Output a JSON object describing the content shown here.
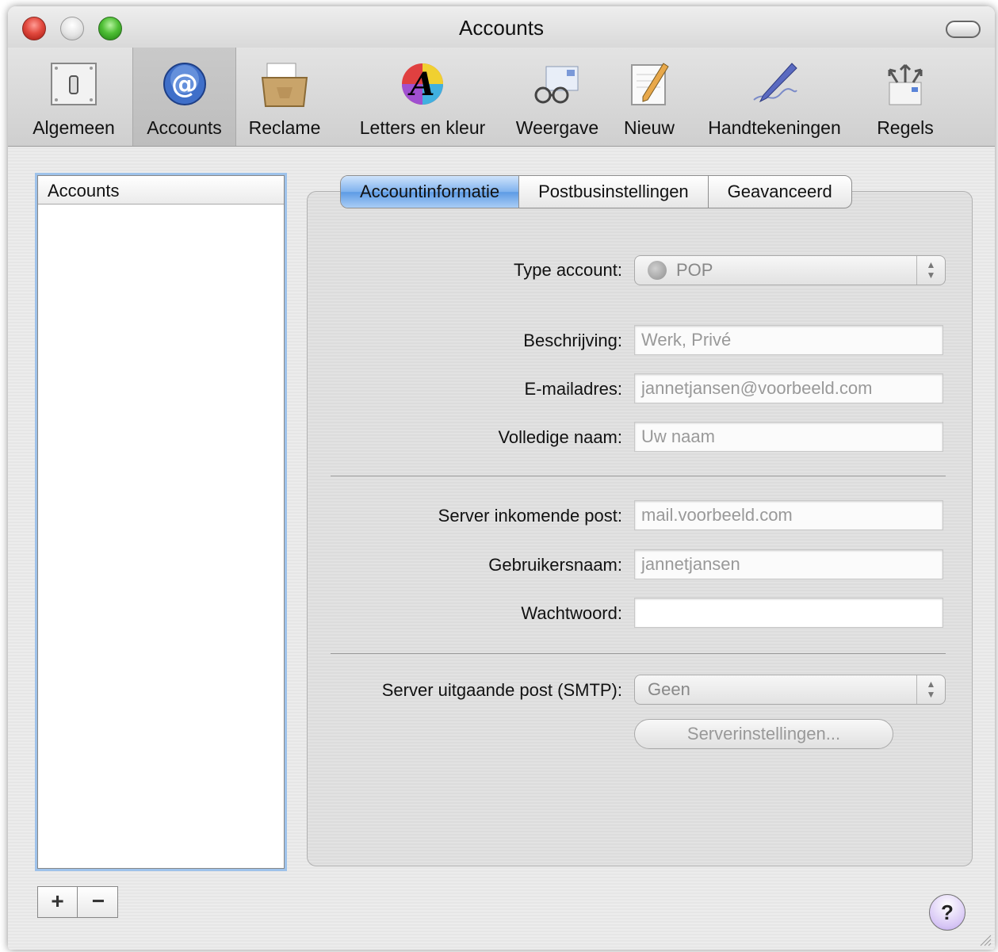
{
  "window": {
    "title": "Accounts"
  },
  "toolbar": {
    "items": [
      {
        "label": "Algemeen",
        "icon": "switch-icon"
      },
      {
        "label": "Accounts",
        "icon": "at-icon",
        "selected": true
      },
      {
        "label": "Reclame",
        "icon": "junk-mail-icon"
      },
      {
        "label": "Letters en kleur",
        "icon": "font-color-icon"
      },
      {
        "label": "Weergave",
        "icon": "glasses-icon"
      },
      {
        "label": "Nieuw",
        "icon": "notepad-pencil-icon"
      },
      {
        "label": "Handtekeningen",
        "icon": "signature-pen-icon"
      },
      {
        "label": "Regels",
        "icon": "rules-arrows-icon"
      }
    ]
  },
  "accounts_list": {
    "header": "Accounts",
    "items": []
  },
  "list_buttons": {
    "add": "+",
    "remove": "−"
  },
  "tabs": [
    {
      "label": "Accountinformatie",
      "active": true
    },
    {
      "label": "Postbusinstellingen",
      "active": false
    },
    {
      "label": "Geavanceerd",
      "active": false
    }
  ],
  "form": {
    "type_label": "Type account:",
    "type_value": "POP",
    "description_label": "Beschrijving:",
    "description_placeholder": "Werk, Privé",
    "email_label": "E-mailadres:",
    "email_placeholder": "jannetjansen@voorbeeld.com",
    "fullname_label": "Volledige naam:",
    "fullname_placeholder": "Uw naam",
    "incoming_label": "Server inkomende post:",
    "incoming_placeholder": "mail.voorbeeld.com",
    "username_label": "Gebruikersnaam:",
    "username_placeholder": "jannetjansen",
    "password_label": "Wachtwoord:",
    "password_value": "",
    "smtp_label": "Server uitgaande post (SMTP):",
    "smtp_value": "Geen",
    "server_settings_button": "Serverinstellingen..."
  },
  "help": {
    "label": "?"
  },
  "colors": {
    "selection_blue": "#5d9be5",
    "focus_ring": "#9ec2ea",
    "close": "#e24a3f",
    "zoom": "#4fbf35"
  }
}
